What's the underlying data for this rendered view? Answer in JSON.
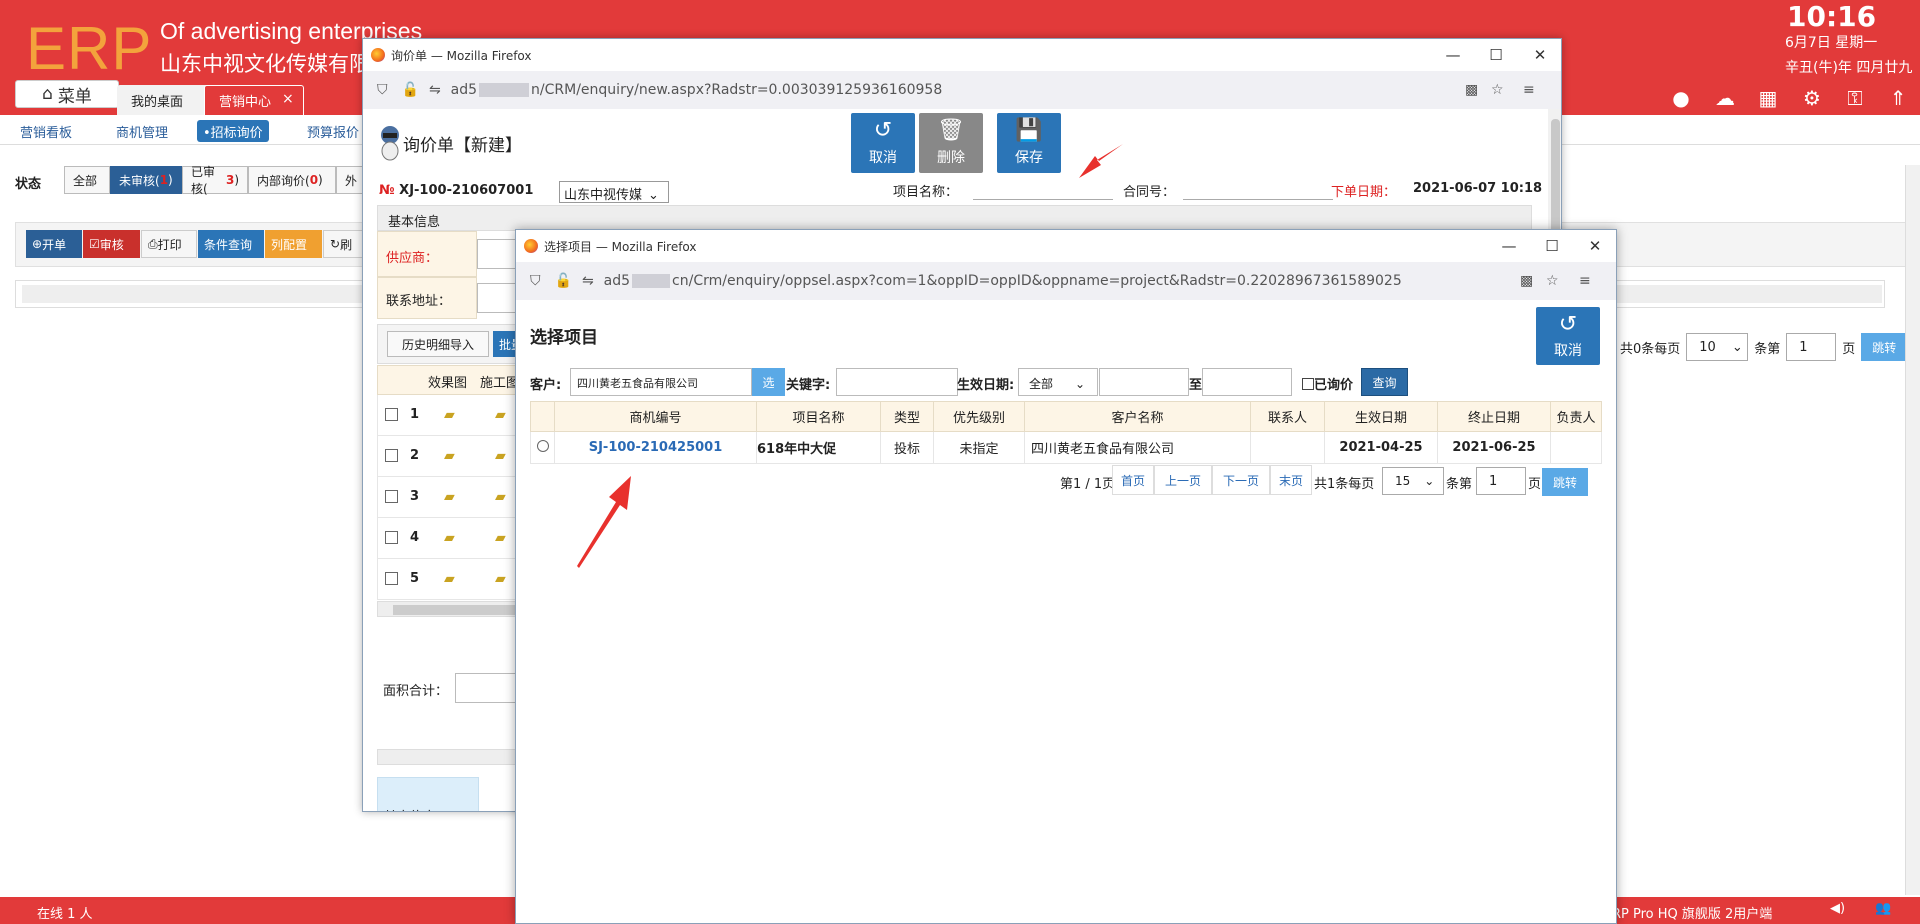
{
  "header": {
    "logo": "ERP",
    "sub1": "Of advertising enterprises",
    "sub2": "山东中视文化传媒有限",
    "menu": "菜单",
    "tab_desk": "我的桌面",
    "tab_mkt": "营销中心",
    "tab_close": "×",
    "clock": "10:16",
    "date1": "6月7日 星期一",
    "date2": "辛丑(牛)年 四月廿九",
    "icons": [
      "user-icon",
      "cloud-upload-icon",
      "grid-icon",
      "gear-icon",
      "key-icon",
      "up-icon"
    ]
  },
  "subnav": [
    "营销看板",
    "商机管理",
    "•招标询价",
    "预算报价"
  ],
  "status": {
    "label": "状态",
    "items": [
      {
        "label": "全部",
        "count": ""
      },
      {
        "label": "未审核(",
        "count": "1",
        ")": ""
      },
      {
        "label": "已审核(",
        "count": "3"
      },
      {
        "label": "内部询价(",
        "count": "0"
      },
      {
        "label": "外",
        "count": ""
      }
    ]
  },
  "toolbar": {
    "open": "开单",
    "audit": "审核",
    "print": "打印",
    "query": "条件查询",
    "colset": "列配置",
    "refresh": "刷"
  },
  "pager_right": {
    "total": "共0条每页",
    "per": "10",
    "page_label": "条第",
    "page": "1",
    "page_unit": "页",
    "jump": "跳转"
  },
  "footer": {
    "online": "在线  1  人",
    "version": "RP Pro HQ 旗舰版 2用户端"
  },
  "win1": {
    "title": "询价单 — Mozilla Firefox",
    "url_pre": "ad5",
    "url_post": "n/CRM/enquiry/new.aspx?Radstr=0.003039125936160958",
    "heading": "询价单【新建】",
    "btn_cancel": "取消",
    "btn_delete": "删除",
    "btn_save": "保存",
    "doc_no_sym": "№",
    "doc_no": "XJ-100-210607001",
    "company": "山东中视传媒",
    "proj_label": "项目名称：",
    "contract_label": "合同号：",
    "date_label": "下单日期：",
    "date": "2021-06-07 10:18",
    "basic": "基本信息",
    "supplier": "供应商：",
    "address": "联系地址：",
    "history": "历史明细导入",
    "batch": "批量",
    "col_img": "效果图",
    "col_work": "施工图",
    "rows": [
      "1",
      "2",
      "3",
      "4",
      "5"
    ],
    "area": "面积合计：",
    "other": "其它约定"
  },
  "win2": {
    "title": "选择项目 — Mozilla Firefox",
    "url_pre": "ad5",
    "url_post": "cn/Crm/enquiry/oppsel.aspx?com=1&oppID=oppID&oppname=project&Radstr=0.22028967361589025",
    "heading": "选择项目",
    "cancel": "取消",
    "customer_label": "客户:",
    "customer_value": "四川黄老五食品有限公司",
    "sel": "选",
    "keyword_label": "关键字:",
    "eff_label": "生效日期:",
    "eff_option": "全部",
    "to": "至",
    "inquired": "已询价",
    "query": "查询",
    "columns": [
      "商机编号",
      "项目名称",
      "类型",
      "优先级别",
      "客户名称",
      "联系人",
      "生效日期",
      "终止日期",
      "负责人"
    ],
    "rows": [
      {
        "code": "SJ-100-210425001",
        "name": "618年中大促",
        "type": "投标",
        "priority": "未指定",
        "customer": "四川黄老五食品有限公司",
        "contact": "",
        "start": "2021-04-25",
        "end": "2021-06-25",
        "owner": ""
      }
    ],
    "pager": {
      "page_info": "第1 / 1页",
      "first": "首页",
      "prev": "上一页",
      "next": "下一页",
      "last": "末页",
      "total": "共1条每页",
      "per": "15",
      "page_label": "条第",
      "page": "1",
      "page_unit": "页",
      "jump": "跳转"
    }
  },
  "colors": {
    "brand_red": "#e23a3a",
    "accent_blue": "#2b75b7",
    "logo_orange": "#f3a33c",
    "arrow_red": "#e8312d"
  }
}
